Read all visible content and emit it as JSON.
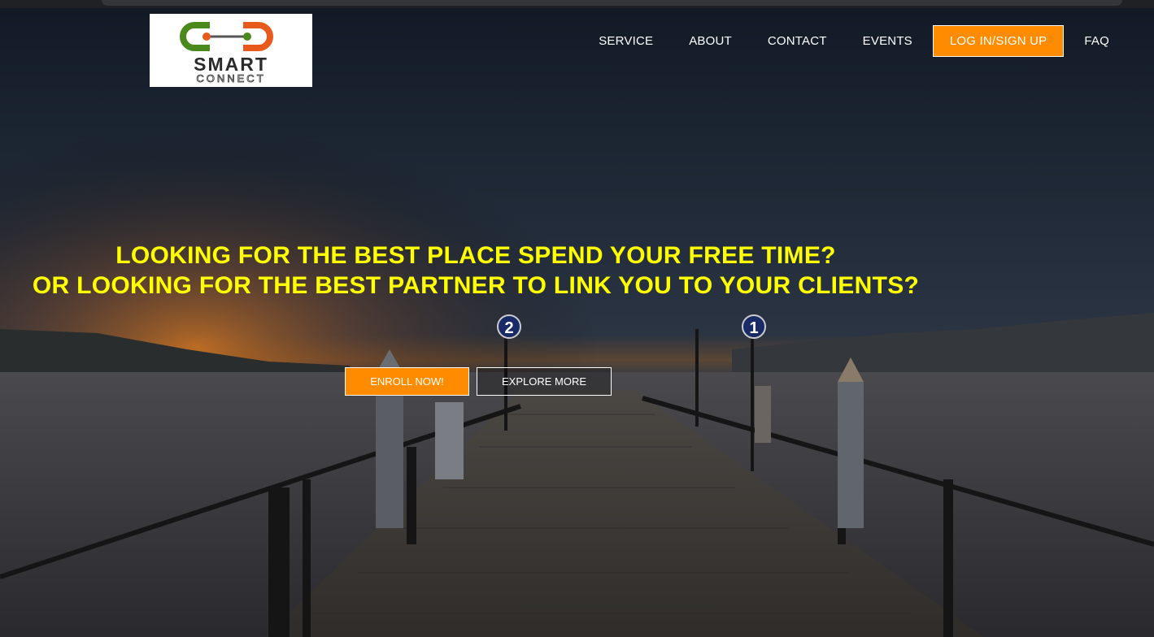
{
  "brand": {
    "logo_top": "SMART",
    "logo_bottom": "CONNECT"
  },
  "nav": {
    "items": [
      "SERVICE",
      "ABOUT",
      "CONTACT",
      "EVENTS"
    ],
    "login_label": "LOG IN/SIGN UP",
    "faq_label": "FAQ"
  },
  "hero": {
    "headline_line1": "LOOKING FOR THE BEST PLACE SPEND YOUR FREE TIME?",
    "headline_line2": "OR LOOKING FOR THE BEST PARTNER TO LINK YOU TO YOUR CLIENTS?",
    "enroll_label": "ENROLL NOW!",
    "explore_label": "EXPLORE MORE",
    "sign_left": "2",
    "sign_right": "1"
  },
  "colors": {
    "accent": "#ff8c00",
    "headline": "#ffff00",
    "logo_green": "#4a8a1c",
    "logo_orange": "#e85a1b"
  }
}
